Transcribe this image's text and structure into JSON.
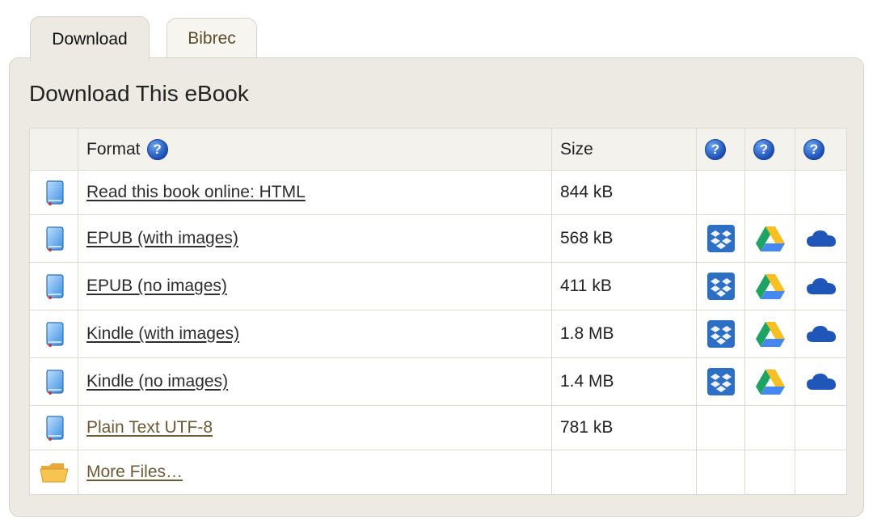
{
  "tabs": {
    "download": "Download",
    "bibrec": "Bibrec"
  },
  "panel": {
    "title": "Download This eBook"
  },
  "table": {
    "headers": {
      "format": "Format",
      "size": "Size",
      "help_glyph": "?"
    },
    "rows": [
      {
        "icon": "ebook-icon",
        "label": "Read this book online: HTML",
        "size": "844 kB",
        "services": false
      },
      {
        "icon": "ebook-icon",
        "label": "EPUB (with images)",
        "size": "568 kB",
        "services": true
      },
      {
        "icon": "ebook-icon",
        "label": "EPUB (no images)",
        "size": "411 kB",
        "services": true
      },
      {
        "icon": "ebook-icon",
        "label": "Kindle (with images)",
        "size": "1.8 MB",
        "services": true
      },
      {
        "icon": "ebook-icon",
        "label": "Kindle (no images)",
        "size": "1.4 MB",
        "services": true
      },
      {
        "icon": "ebook-icon",
        "label": "Plain Text UTF-8",
        "size": "781 kB",
        "services": false
      },
      {
        "icon": "folder-icon",
        "label": "More Files…",
        "size": "",
        "services": false
      }
    ],
    "service_icons": [
      "dropbox-icon",
      "google-drive-icon",
      "onedrive-icon"
    ]
  },
  "colors": {
    "panel_bg": "#eceae2",
    "link_alt": "#6b5a36",
    "help_blue": "#1d4fb5"
  }
}
